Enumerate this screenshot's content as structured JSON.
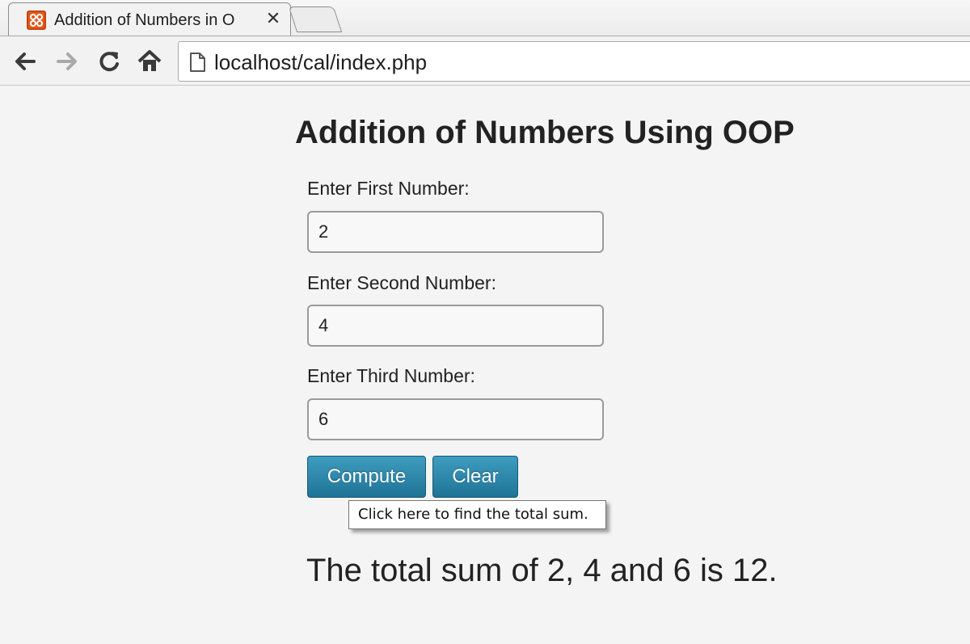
{
  "browser": {
    "tab": {
      "title": "Addition of Numbers in O",
      "close": "✕",
      "favicon": "xampp-icon"
    },
    "toolbar": {
      "back_icon": "back-arrow-icon",
      "forward_icon": "forward-arrow-icon",
      "reload_icon": "reload-icon",
      "home_icon": "home-icon"
    },
    "address": {
      "url": "localhost/cal/index.php",
      "page_icon": "page-icon"
    }
  },
  "form": {
    "heading": "Addition of Numbers Using OOP",
    "fields": [
      {
        "label": "Enter First Number:",
        "value": "2"
      },
      {
        "label": "Enter Second Number:",
        "value": "4"
      },
      {
        "label": "Enter Third Number:",
        "value": "6"
      }
    ],
    "compute_label": "Compute",
    "clear_label": "Clear",
    "tooltip": "Click here to find the total sum.",
    "result": "The total sum of 2, 4 and 6 is 12."
  },
  "colors": {
    "button_top": "#3e9dbf",
    "button_bottom": "#1f7396",
    "favicon": "#e35b1e"
  }
}
